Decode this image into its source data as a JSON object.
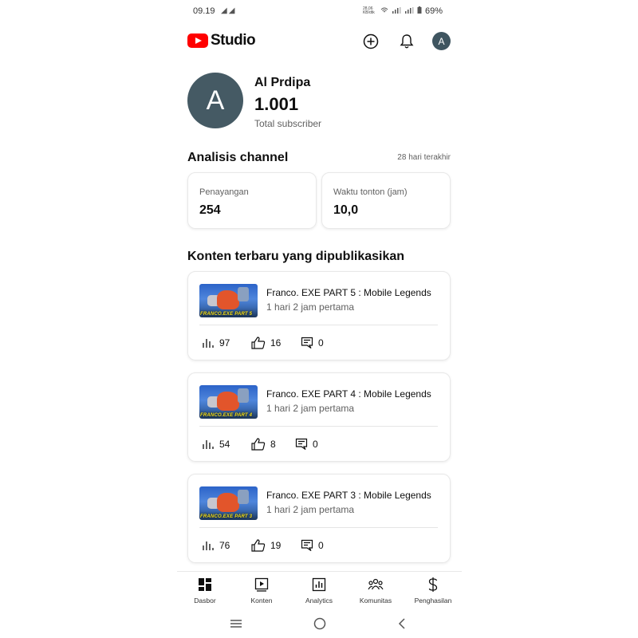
{
  "status_bar": {
    "time": "09.19",
    "notif_icons": [
      "telegram-icon",
      "telegram-icon"
    ],
    "tiny_text": "28,06 KB/dtk",
    "battery": "69%"
  },
  "header": {
    "logo_text": "Studio",
    "accent": "#ff0000",
    "avatar_letter": "A"
  },
  "profile": {
    "avatar_letter": "A",
    "name": "Al Prdipa",
    "subscribers": "1.001",
    "subscribers_label": "Total subscriber"
  },
  "analytics": {
    "title": "Analisis channel",
    "period": "28 hari terakhir",
    "cards": [
      {
        "label": "Penayangan",
        "value": "254"
      },
      {
        "label": "Waktu tonton (jam)",
        "value": "10,0"
      }
    ]
  },
  "recent": {
    "title": "Konten terbaru yang dipublikasikan",
    "videos": [
      {
        "thumb_text": "FRANCO.EXE PART 5",
        "title": "Franco. EXE PART 5 : Mobile Legends",
        "subtitle": "1 hari 2 jam pertama",
        "views": "97",
        "likes": "16",
        "comments": "0"
      },
      {
        "thumb_text": "FRANCO.EXE PART 4",
        "title": "Franco. EXE PART 4 : Mobile Legends",
        "subtitle": "1 hari 2 jam pertama",
        "views": "54",
        "likes": "8",
        "comments": "0"
      },
      {
        "thumb_text": "FRANCO.EXE PART 3",
        "title": "Franco. EXE PART 3 : Mobile Legends",
        "subtitle": "1 hari 2 jam pertama",
        "views": "76",
        "likes": "19",
        "comments": "0"
      }
    ]
  },
  "bottom_nav": [
    {
      "label": "Dasbor",
      "icon": "dashboard-icon",
      "active": true
    },
    {
      "label": "Konten",
      "icon": "content-icon"
    },
    {
      "label": "Analytics",
      "icon": "analytics-icon"
    },
    {
      "label": "Komunitas",
      "icon": "community-icon"
    },
    {
      "label": "Penghasilan",
      "icon": "earnings-icon"
    }
  ],
  "system_nav": [
    "recents-icon",
    "home-icon",
    "back-icon"
  ]
}
